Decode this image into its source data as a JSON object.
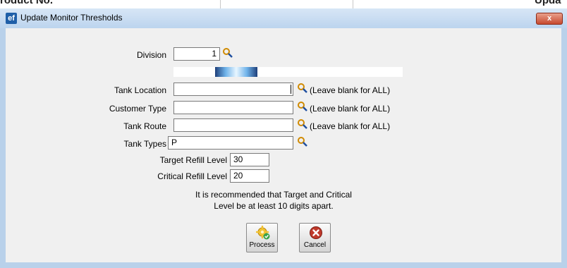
{
  "background": {
    "left_text": "roduct No.",
    "right_text": "Upda"
  },
  "window": {
    "title": "Update Monitor Thresholds",
    "icon_text": "ef",
    "close_label": "x"
  },
  "form": {
    "division": {
      "label": "Division",
      "value": "1"
    },
    "progress": {
      "fraction": 0.18
    },
    "tank_location": {
      "label": "Tank Location",
      "value": "",
      "hint": "(Leave blank for ALL)"
    },
    "customer_type": {
      "label": "Customer Type",
      "value": "",
      "hint": "(Leave blank for ALL)"
    },
    "tank_route": {
      "label": "Tank Route",
      "value": "",
      "hint": "(Leave blank for ALL)"
    },
    "tank_types": {
      "label": "Tank Types",
      "value": "P"
    },
    "target_refill": {
      "label": "Target Refill Level",
      "value": "30"
    },
    "critical_refill": {
      "label": "Critical Refill Level",
      "value": "20"
    },
    "note_line1": "It is recommended that Target and Critical",
    "note_line2": "Level be at least 10 digits apart."
  },
  "buttons": {
    "process": "Process",
    "cancel": "Cancel"
  },
  "colors": {
    "window_frame": "#b9d1ea",
    "client_bg": "#f0f0f0",
    "lookup_icon": "#d08a00",
    "cancel_icon": "#c0392b"
  },
  "icons": {
    "lookup": "magnifier-icon",
    "process": "gear-check-icon",
    "cancel": "cancel-circle-icon"
  }
}
